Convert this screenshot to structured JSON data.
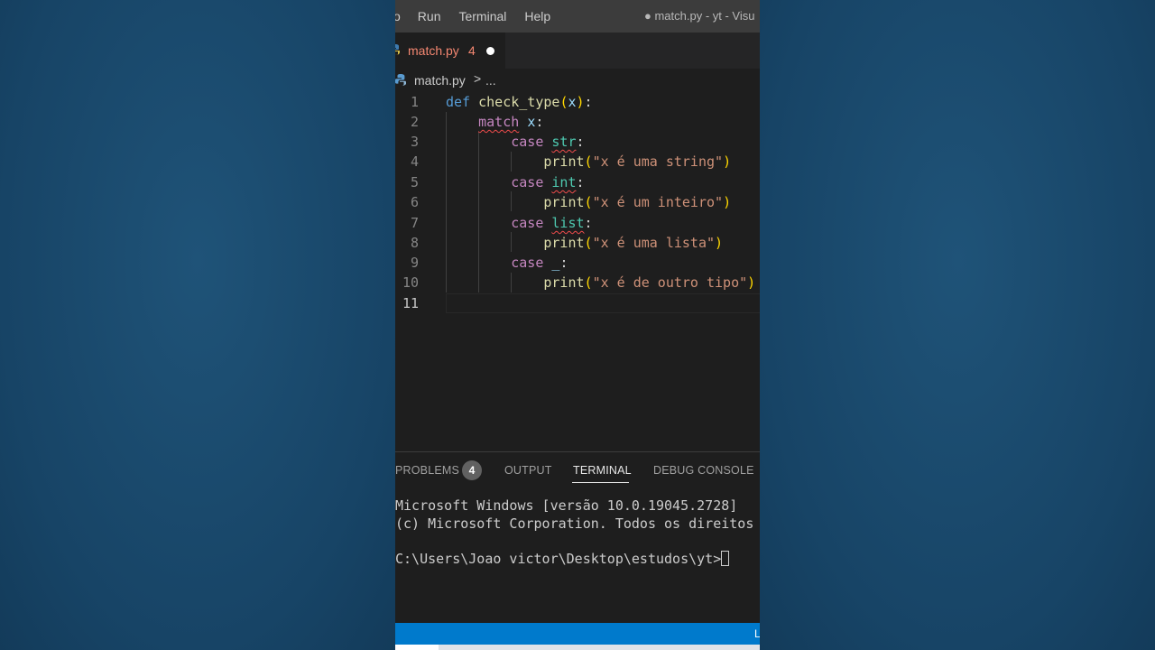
{
  "menubar": {
    "items": [
      "o",
      "Run",
      "Terminal",
      "Help"
    ],
    "window_title": "● match.py - yt - Visu"
  },
  "tab": {
    "filename": "match.py",
    "problem_count": "4"
  },
  "breadcrumb": {
    "file": "match.py",
    "separator": ">",
    "more": "..."
  },
  "editor": {
    "line_numbers": [
      "1",
      "2",
      "3",
      "4",
      "5",
      "6",
      "7",
      "8",
      "9",
      "10",
      "11"
    ],
    "lines": [
      "def check_type(x):",
      "    match x:",
      "        case str:",
      "            print(\"x é uma string\")",
      "        case int:",
      "            print(\"x é um inteiro\")",
      "        case list:",
      "            print(\"x é uma lista\")",
      "        case _:",
      "            print(\"x é de outro tipo\")",
      ""
    ],
    "tokens": {
      "def": "def",
      "fn": "check_type",
      "x": "x",
      "match": "match",
      "case": "case",
      "str": "str",
      "int": "int",
      "list": "list",
      "underscore": "_",
      "print": "print",
      "s1": "\"x é uma string\"",
      "s2": "\"x é um inteiro\"",
      "s3": "\"x é uma lista\"",
      "s4": "\"x é de outro tipo\""
    }
  },
  "panel": {
    "tabs": [
      "PROBLEMS",
      "OUTPUT",
      "TERMINAL",
      "DEBUG CONSOLE"
    ],
    "problems_badge": "4",
    "active_tab": "TERMINAL"
  },
  "terminal": {
    "lines": [
      "Microsoft Windows [versão 10.0.19045.2728]",
      "(c) Microsoft Corporation. Todos os direitos r",
      "",
      "C:\\Users\\Joao victor\\Desktop\\estudos\\yt>"
    ]
  },
  "statusbar": {
    "right_text": "L"
  },
  "colors": {
    "background": "#1b4a6e",
    "editor_bg": "#1e1e1e",
    "statusbar": "#007acc",
    "error_tab": "#f48771"
  }
}
